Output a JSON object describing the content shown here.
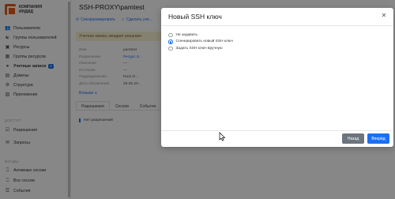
{
  "sidebar": {
    "logo_text_line1": "КОМПАНИЯ",
    "logo_text_line2": "ИНДИД",
    "items": [
      {
        "label": "Пользователи",
        "icon": "users-icon"
      },
      {
        "label": "Группы пользователей",
        "icon": "user-group-icon"
      },
      {
        "label": "Ресурсы",
        "icon": "resource-icon"
      },
      {
        "label": "Группы ресурсов",
        "icon": "resource-group-icon"
      },
      {
        "label": "Учетные записи",
        "icon": "account-icon",
        "badge": "2"
      },
      {
        "label": "Домены",
        "icon": "domain-icon"
      },
      {
        "label": "Структура",
        "icon": "structure-icon"
      },
      {
        "label": "Приложения",
        "icon": "apps-icon"
      }
    ],
    "section2_label": "ДОСТУП",
    "items2": [
      {
        "label": "Разрешения",
        "icon": "permissions-icon"
      },
      {
        "label": "Запросы",
        "icon": "requests-icon"
      }
    ],
    "section3_label": "ВХОДЫ",
    "items3": [
      {
        "label": "Активные сессии",
        "icon": "active-sessions-icon"
      },
      {
        "label": "Все сессии",
        "icon": "all-sessions-icon"
      },
      {
        "label": "События",
        "icon": "events-icon"
      }
    ]
  },
  "main": {
    "title": "SSH-PROXY\\pamtest",
    "toolbar": [
      "Синхронизировать",
      "Сделать уче..."
    ],
    "warning": "Учетная запись ожидает решения",
    "props_labels": [
      "Имя",
      "Разрешение",
      "Описание",
      "Источник",
      "Подразделение",
      "Дата обновления"
    ],
    "props_values": [
      "pamtest",
      "Ресурс S...",
      "—",
      "—",
      "Root O...",
      "29.05.20..."
    ],
    "more": "Больше ∨",
    "tabs": [
      "Разрешения",
      "Сессии",
      "События"
    ],
    "no_permissions": "Нет разрешений"
  },
  "modal": {
    "title": "Новый SSH ключ",
    "options": [
      {
        "label": "Не задавать",
        "checked": false
      },
      {
        "label": "Сгенерировать новый SSH ключ",
        "checked": true
      },
      {
        "label": "Задать SSH ключ вручную",
        "checked": false
      }
    ],
    "back_label": "Назад",
    "next_label": "Вперёд"
  },
  "colors": {
    "accent": "#1b6ff5",
    "secondary_button": "#6c757d",
    "brand": "#e25c1d"
  }
}
